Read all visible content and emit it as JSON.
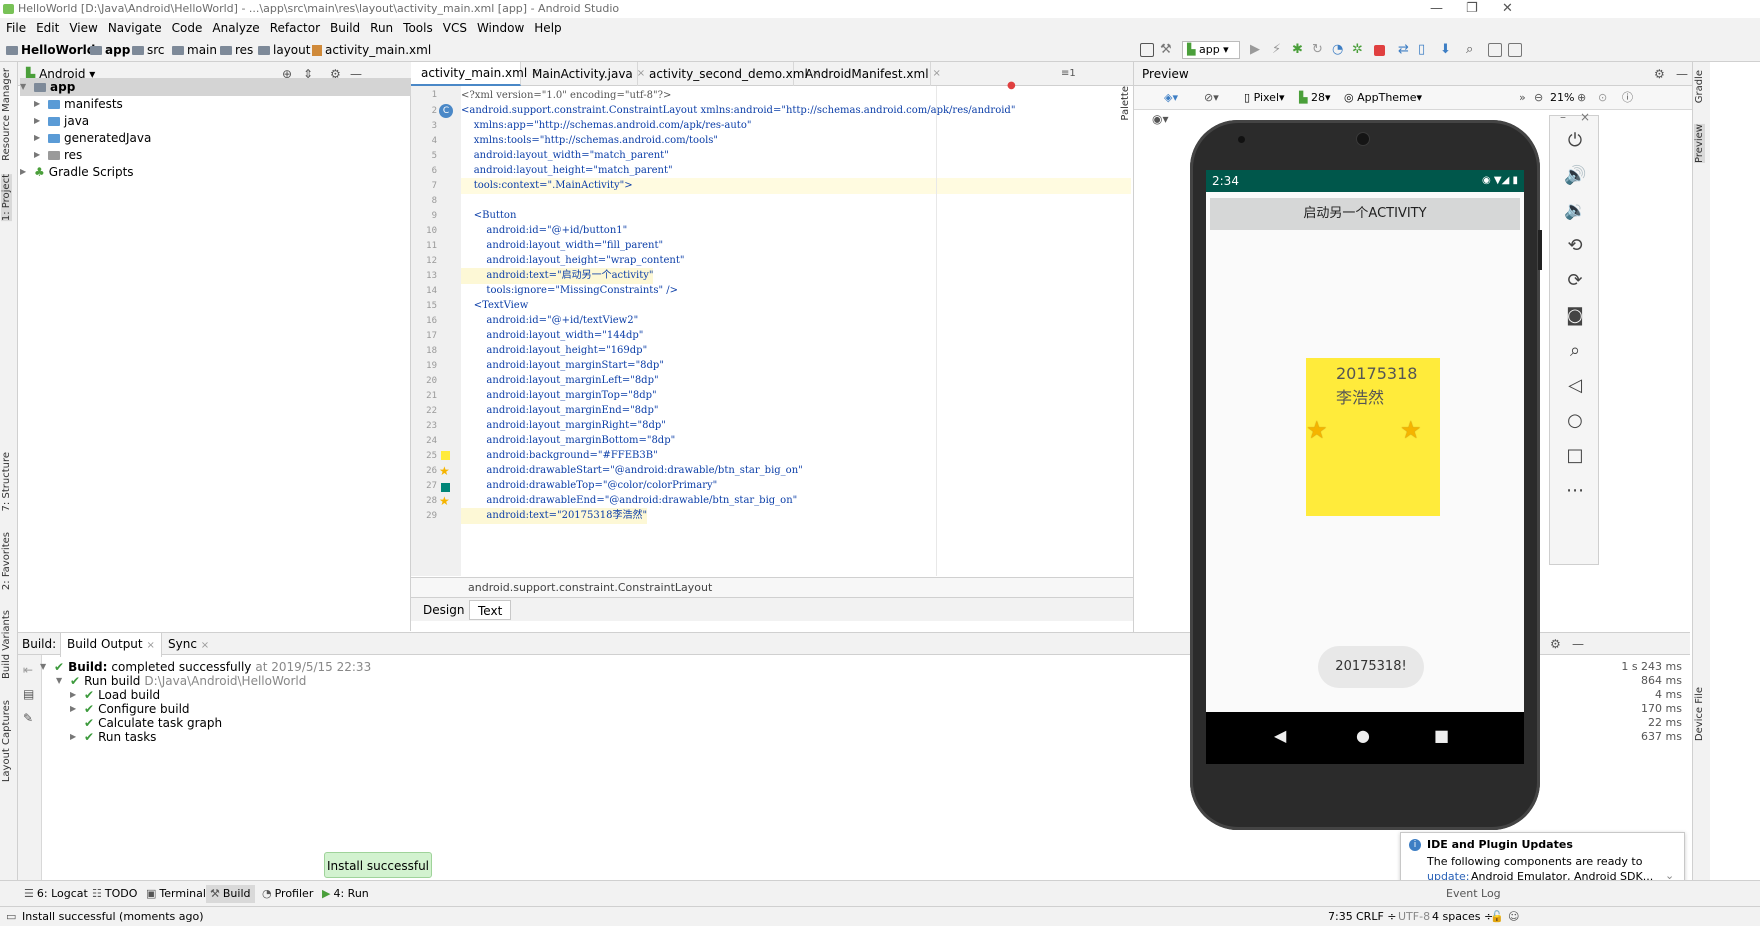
{
  "window": {
    "title": "HelloWorld [D:\\Java\\Android\\HelloWorld] - ...\\app\\src\\main\\res\\layout\\activity_main.xml [app] - Android Studio",
    "controls": [
      "—",
      "❐",
      "✕"
    ]
  },
  "menu": [
    "File",
    "Edit",
    "View",
    "Navigate",
    "Code",
    "Analyze",
    "Refactor",
    "Build",
    "Run",
    "Tools",
    "VCS",
    "Window",
    "Help"
  ],
  "breadcrumbs": [
    "HelloWorld",
    "app",
    "src",
    "main",
    "res",
    "layout",
    "activity_main.xml"
  ],
  "run_config": "app",
  "left_tool_tabs": [
    "Resource Manager",
    "1: Project",
    "7: Structure",
    "2: Favorites",
    "Build Variants",
    "Layout Captures"
  ],
  "right_tool_tabs": [
    "Gradle",
    "Preview",
    "Device File"
  ],
  "project": {
    "view": "Android",
    "tree": [
      {
        "label": "app",
        "level": 0,
        "expanded": true,
        "bold": true
      },
      {
        "label": "manifests",
        "level": 1
      },
      {
        "label": "java",
        "level": 1
      },
      {
        "label": "generatedJava",
        "level": 1
      },
      {
        "label": "res",
        "level": 1
      },
      {
        "label": "Gradle Scripts",
        "level": 0
      }
    ]
  },
  "editor": {
    "tabs": [
      "activity_main.xml",
      "MainActivity.java",
      "activity_second_demo.xml",
      "AndroidManifest.xml"
    ],
    "tab_overflow": "≡1",
    "lines": [
      "<?xml version=\"1.0\" encoding=\"utf-8\"?>",
      "<android.support.constraint.ConstraintLayout xmlns:android=\"http://schemas.android.com/apk/res/android\"",
      "    xmlns:app=\"http://schemas.android.com/apk/res-auto\"",
      "    xmlns:tools=\"http://schemas.android.com/tools\"",
      "    android:layout_width=\"match_parent\"",
      "    android:layout_height=\"match_parent\"",
      "    tools:context=\".MainActivity\">",
      "",
      "    <Button",
      "        android:id=\"@+id/button1\"",
      "        android:layout_width=\"fill_parent\"",
      "        android:layout_height=\"wrap_content\"",
      "        android:text=\"启动另一个activity\"",
      "        tools:ignore=\"MissingConstraints\" />",
      "    <TextView",
      "        android:id=\"@+id/textView2\"",
      "        android:layout_width=\"144dp\"",
      "        android:layout_height=\"169dp\"",
      "        android:layout_marginStart=\"8dp\"",
      "        android:layout_marginLeft=\"8dp\"",
      "        android:layout_marginTop=\"8dp\"",
      "        android:layout_marginEnd=\"8dp\"",
      "        android:layout_marginRight=\"8dp\"",
      "        android:layout_marginBottom=\"8dp\"",
      "        android:background=\"#FFEB3B\"",
      "        android:drawableStart=\"@android:drawable/btn_star_big_on\"",
      "        android:drawableTop=\"@color/colorPrimary\"",
      "        android:drawableEnd=\"@android:drawable/btn_star_big_on\"",
      "        android:text=\"20175318李浩然\""
    ],
    "breadcrumb": "android.support.constraint.ConstraintLayout",
    "bottom_tabs": [
      "Design",
      "Text"
    ],
    "active_bottom_tab": "Text"
  },
  "preview": {
    "title": "Preview",
    "device": "Pixel",
    "api": "28",
    "theme": "AppTheme",
    "zoom": "21%",
    "palette_label": "Palette"
  },
  "phone": {
    "time": "2:34",
    "button_text": "启动另一个ACTIVITY",
    "textview_line1": "20175318",
    "textview_line2": "李浩然",
    "toast": "20175318!",
    "bg_color": "#FFEB3B"
  },
  "build": {
    "tabs": [
      "Build:",
      "Build Output",
      "Sync"
    ],
    "rows": [
      {
        "label": "Build:",
        "detail": "completed successfully",
        "meta": "at 2019/5/15 22:33",
        "time": "1 s 243 ms",
        "level": 0
      },
      {
        "label": "Run build",
        "detail": "",
        "meta": "D:\\Java\\Android\\HelloWorld",
        "time": "864 ms",
        "level": 1
      },
      {
        "label": "Load build",
        "detail": "",
        "meta": "",
        "time": "4 ms",
        "level": 2
      },
      {
        "label": "Configure build",
        "detail": "",
        "meta": "",
        "time": "170 ms",
        "level": 2
      },
      {
        "label": "Calculate task graph",
        "detail": "",
        "meta": "",
        "time": "22 ms",
        "level": 2
      },
      {
        "label": "Run tasks",
        "detail": "",
        "meta": "",
        "time": "637 ms",
        "level": 2
      }
    ]
  },
  "bottom_tabs": [
    "6: Logcat",
    "TODO",
    "Terminal",
    "Build",
    "Profiler",
    "4: Run"
  ],
  "install_popup": "Install successful",
  "notification": {
    "title": "IDE and Plugin Updates",
    "body": "The following components are ready to",
    "link": "update:",
    "rest": "Android Emulator, Android SDK..."
  },
  "status": {
    "message": "Install successful (moments ago)",
    "position": "7:35",
    "line_sep": "CRLF ÷",
    "encoding": "UTF-8",
    "indent": "4 spaces ÷",
    "event_log": "Event Log"
  }
}
